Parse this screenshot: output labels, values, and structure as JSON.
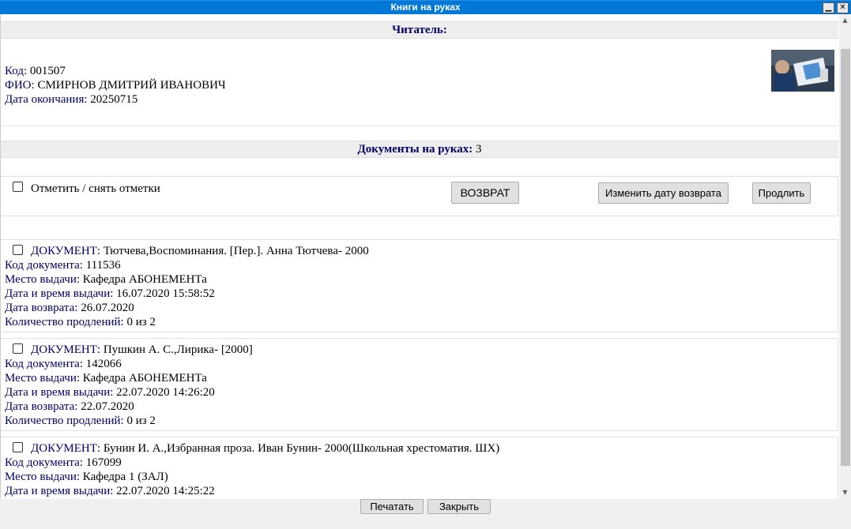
{
  "window": {
    "title": "Книги на руках"
  },
  "reader": {
    "header": "Читатель:",
    "code_label": "Код:",
    "code": "001507",
    "name_label": "ФИО:",
    "name": "СМИРНОВ ДМИТРИЙ ИВАНОВИЧ",
    "end_label": "Дата окончания:",
    "end_date": "20250715"
  },
  "documents": {
    "header": "Документы на руках:",
    "count": "3"
  },
  "toolbar": {
    "mark_all": "Отметить / снять отметки",
    "return": "ВОЗВРАТ",
    "change_date": "Изменить дату возврата",
    "extend": "Продлить"
  },
  "labels": {
    "doc": "ДОКУМЕНТ:",
    "doc_code": "Код документа:",
    "place": "Место выдачи:",
    "issued": "Дата и время выдачи:",
    "return_date": "Дата возврата:",
    "renewals": "Количество продлений:"
  },
  "items": [
    {
      "title": "Тютчева,Воспоминания. [Пер.]. Анна Тютчева- 2000",
      "code": "111536",
      "place": "Кафедра АБОНЕМЕНТа",
      "issued": "16.07.2020 15:58:52",
      "return_date": "26.07.2020",
      "renewals": "0 из 2"
    },
    {
      "title": "Пушкин А. С.,Лирика- [2000]",
      "code": "142066",
      "place": "Кафедра АБОНЕМЕНТа",
      "issued": "22.07.2020 14:26:20",
      "return_date": "22.07.2020",
      "renewals": "0 из 2"
    },
    {
      "title": "Бунин И. А.,Избранная проза. Иван Бунин- 2000(Школьная хрестоматия. ШХ)",
      "code": "167099",
      "place": "Кафедра 1 (ЗАЛ)",
      "issued": "22.07.2020 14:25:22",
      "return_date": "",
      "renewals": ""
    }
  ],
  "footer": {
    "print": "Печатать",
    "close": "Закрыть"
  },
  "icons": {
    "minimize": "minimize-icon",
    "close": "close-icon",
    "scroll_up": "arrow-up-icon",
    "scroll_down": "arrow-down-icon"
  }
}
